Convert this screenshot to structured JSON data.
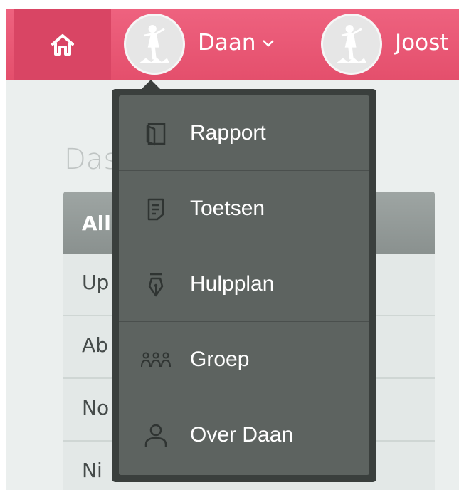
{
  "topbar": {
    "users": [
      {
        "name": "Daan"
      },
      {
        "name": "Joost"
      }
    ]
  },
  "page": {
    "title": "Das",
    "table_header": "All",
    "rows": [
      "Up",
      "Ab",
      "No",
      "Ni"
    ]
  },
  "dropdown": {
    "items": [
      {
        "label": "Rapport",
        "icon": "report-icon"
      },
      {
        "label": "Toetsen",
        "icon": "tests-icon"
      },
      {
        "label": "Hulpplan",
        "icon": "pen-icon"
      },
      {
        "label": "Groep",
        "icon": "group-icon"
      },
      {
        "label": "Over Daan",
        "icon": "user-icon"
      }
    ]
  },
  "colors": {
    "accent": "#e9566f",
    "home_bg": "#d94564",
    "menu_bg": "#5d6360",
    "menu_border": "#3a3f3d"
  }
}
